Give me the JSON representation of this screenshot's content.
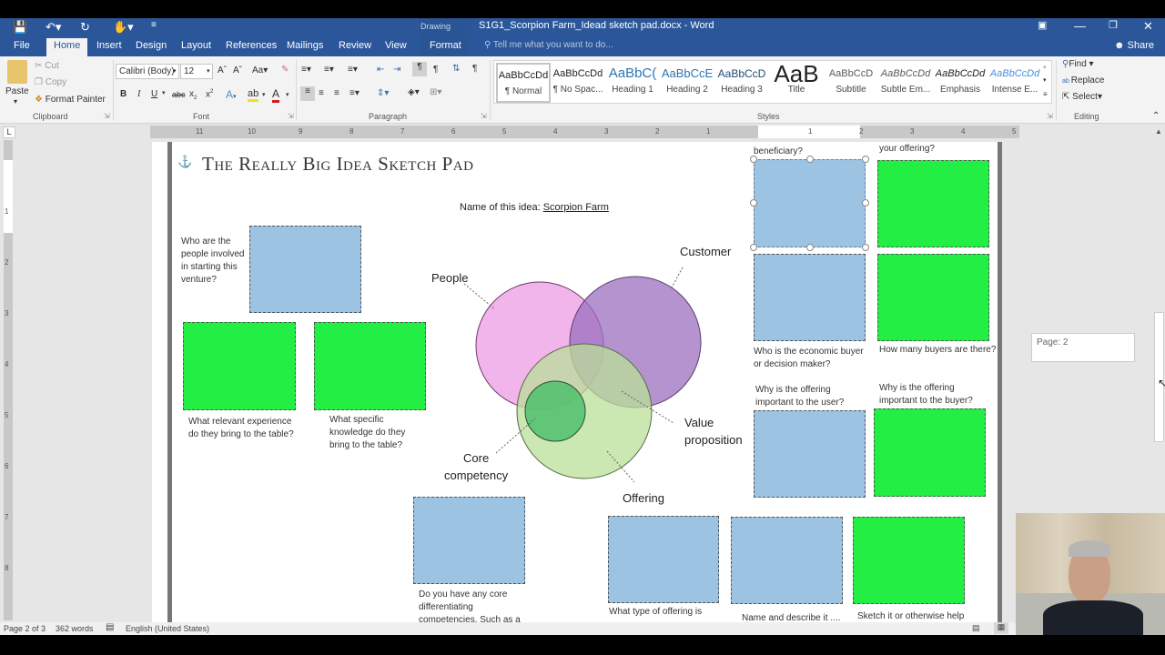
{
  "window": {
    "contextual_tab_group": "Drawing Tools",
    "title": "S1G1_Scorpion Farm_Idead sketch pad.docx - Word"
  },
  "tabs": [
    "File",
    "Home",
    "Insert",
    "Design",
    "Layout",
    "References",
    "Mailings",
    "Review",
    "View",
    "Format"
  ],
  "tell_me_placeholder": "Tell me what you want to do...",
  "share_label": "Share",
  "ribbon": {
    "clipboard": {
      "paste": "Paste",
      "cut": "Cut",
      "copy": "Copy",
      "format_painter": "Format Painter",
      "label": "Clipboard"
    },
    "font": {
      "name": "Calibri (Body)",
      "size": "12",
      "label": "Font",
      "change_case": "Aa"
    },
    "paragraph": {
      "label": "Paragraph"
    },
    "styles": {
      "label": "Styles",
      "items": [
        {
          "preview": "AaBbCcDd",
          "name": "¶ Normal"
        },
        {
          "preview": "AaBbCcDd",
          "name": "¶ No Spac..."
        },
        {
          "preview": "AaBbC(",
          "name": "Heading 1"
        },
        {
          "preview": "AaBbCcE",
          "name": "Heading 2"
        },
        {
          "preview": "AaBbCcD",
          "name": "Heading 3"
        },
        {
          "preview": "AaB",
          "name": "Title"
        },
        {
          "preview": "AaBbCcD",
          "name": "Subtitle"
        },
        {
          "preview": "AaBbCcDd",
          "name": "Subtle Em..."
        },
        {
          "preview": "AaBbCcDd",
          "name": "Emphasis"
        },
        {
          "preview": "AaBbCcDd",
          "name": "Intense E..."
        }
      ]
    },
    "editing": {
      "find": "Find",
      "replace": "Replace",
      "select": "Select",
      "label": "Editing"
    }
  },
  "ruler": {
    "h_labels": [
      "11",
      "10",
      "9",
      "8",
      "7",
      "6",
      "5",
      "4",
      "3",
      "2",
      "1",
      "1",
      "1",
      "2",
      "3",
      "4",
      "5"
    ],
    "v_labels": [
      "1",
      "2",
      "3",
      "4",
      "5",
      "6",
      "7",
      "8"
    ]
  },
  "document": {
    "heading": "The Really Big Idea Sketch Pad",
    "idea_name_label": "Name of this idea:",
    "idea_name_value": "Scorpion Farm",
    "questions": {
      "people_involved": "Who are the people involved in starting this venture?",
      "experience": "What relevant experience do they bring to the table?",
      "knowledge": "What specific knowledge do they bring to the table?",
      "core_competencies": "Do you have any core differentiating competencies. Such as a",
      "beneficiary": "beneficiary?",
      "your_offering": "your offering?",
      "economic_buyer": "Who is the economic buyer or decision maker?",
      "how_many_buyers": "How many buyers are there?",
      "important_user": "Why is the offering important to the user?",
      "important_buyer": "Why is the offering important to the buyer?",
      "offering_type": "What type of offering is",
      "name_describe": "Name and describe it ....",
      "sketch": "Sketch it or otherwise help"
    },
    "venn": {
      "people": "People",
      "customer": "Customer",
      "value_prop_1": "Value",
      "value_prop_2": "proposition",
      "core_1": "Core",
      "core_2": "competency",
      "offering": "Offering"
    }
  },
  "page_tooltip": "Page: 2",
  "status": {
    "page": "Page 2 of 3",
    "words": "362 words",
    "language": "English (United States)"
  },
  "colors": {
    "accent": "#2b579a",
    "box_blue": "#9dc3e2",
    "box_green": "#22ee44",
    "venn_people": "#f0a8e8",
    "venn_customer": "#a77fc4",
    "venn_offering": "#c2e3a3",
    "venn_core": "#5fc47a"
  }
}
